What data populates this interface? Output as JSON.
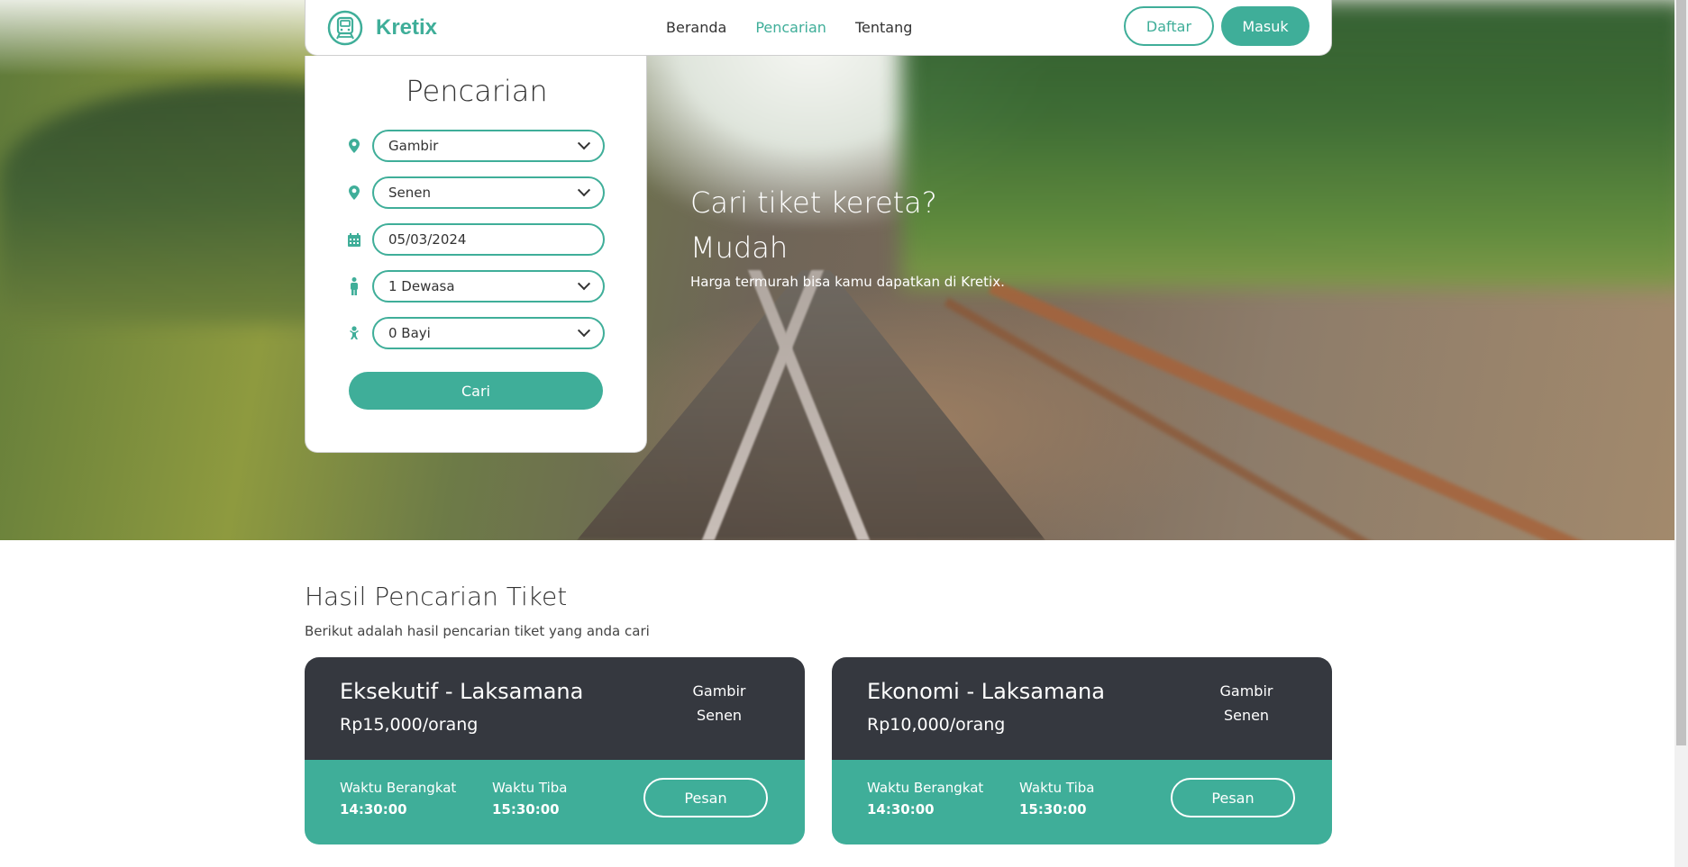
{
  "colors": {
    "accent": "#3fae99",
    "dark_card": "#35383f"
  },
  "navbar": {
    "brand": "Kretix",
    "links": [
      "Beranda",
      "Pencarian",
      "Tentang"
    ],
    "active_link": "Pencarian",
    "register_label": "Daftar",
    "login_label": "Masuk"
  },
  "search": {
    "title": "Pencarian",
    "origin": "Gambir",
    "destination": "Senen",
    "date": "05/03/2024",
    "adults": "1 Dewasa",
    "infants": "0 Bayi",
    "submit_label": "Cari"
  },
  "hero": {
    "line1": "Cari tiket kereta?",
    "line2": "Mudah",
    "subtitle": "Harga termurah bisa kamu dapatkan di Kretix."
  },
  "results": {
    "title": "Hasil Pencarian Tiket",
    "subtitle": "Berikut adalah hasil pencarian tiket yang anda cari",
    "tickets": [
      {
        "name": "Eksekutif - Laksamana",
        "price": "Rp15,000/orang",
        "from": "Gambir",
        "to": "Senen",
        "depart_label": "Waktu Berangkat",
        "depart_time": "14:30:00",
        "arrive_label": "Waktu Tiba",
        "arrive_time": "15:30:00",
        "book_label": "Pesan"
      },
      {
        "name": "Ekonomi - Laksamana",
        "price": "Rp10,000/orang",
        "from": "Gambir",
        "to": "Senen",
        "depart_label": "Waktu Berangkat",
        "depart_time": "14:30:00",
        "arrive_label": "Waktu Tiba",
        "arrive_time": "15:30:00",
        "book_label": "Pesan"
      }
    ]
  }
}
